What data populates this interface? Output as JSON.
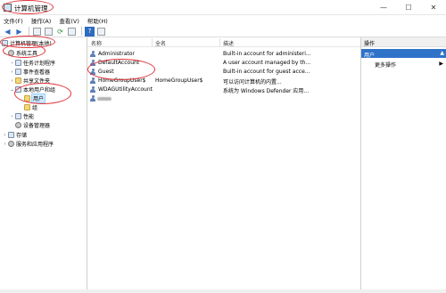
{
  "window": {
    "title": "计算机管理",
    "controls": {
      "minimize": "—",
      "maximize": "☐",
      "close": "✕"
    }
  },
  "menu": [
    {
      "label": "文件(F)"
    },
    {
      "label": "操作(A)"
    },
    {
      "label": "查看(V)"
    },
    {
      "label": "帮助(H)"
    }
  ],
  "toolbar": {
    "icons": [
      "back-arrow-icon",
      "forward-arrow-icon",
      "up-folder-icon",
      "show-hide-tree-icon",
      "refresh-icon",
      "export-list-icon",
      "help-icon",
      "properties-icon"
    ]
  },
  "tree": {
    "root": "计算机管理(本地)",
    "system_tools": "系统工具",
    "task_scheduler": "任务计划程序",
    "event_viewer": "事件查看器",
    "shared_folders": "共享文件夹",
    "local_users_groups": "本地用户和组",
    "users": "用户",
    "groups": "组",
    "performance": "性能",
    "device_manager": "设备管理器",
    "storage": "存储",
    "services_apps": "服务和应用程序"
  },
  "list": {
    "columns": {
      "name": "名称",
      "full_name": "全名",
      "description": "描述"
    },
    "rows": [
      {
        "name": "Administrator",
        "full_name": "",
        "description": "Built-in account for administeri..."
      },
      {
        "name": "DefaultAccount",
        "full_name": "",
        "description": "A user account managed by th..."
      },
      {
        "name": "Guest",
        "full_name": "",
        "description": "Built-in account for guest acce..."
      },
      {
        "name": "HomeGroupUser$",
        "full_name": "HomeGroupUser$",
        "description": "可以访问计算机的内置..."
      },
      {
        "name": "WDAGUtilityAccount",
        "full_name": "",
        "description": "系统为 Windows Defender 应用..."
      },
      {
        "name": "",
        "full_name": "",
        "description": ""
      }
    ]
  },
  "actions": {
    "header": "操作",
    "section": "用户",
    "more": "更多操作"
  },
  "colors": {
    "selection_bg": "#cce8ff",
    "actions_section_bg": "#2f73c8",
    "annotation_red": "#e0343a"
  }
}
